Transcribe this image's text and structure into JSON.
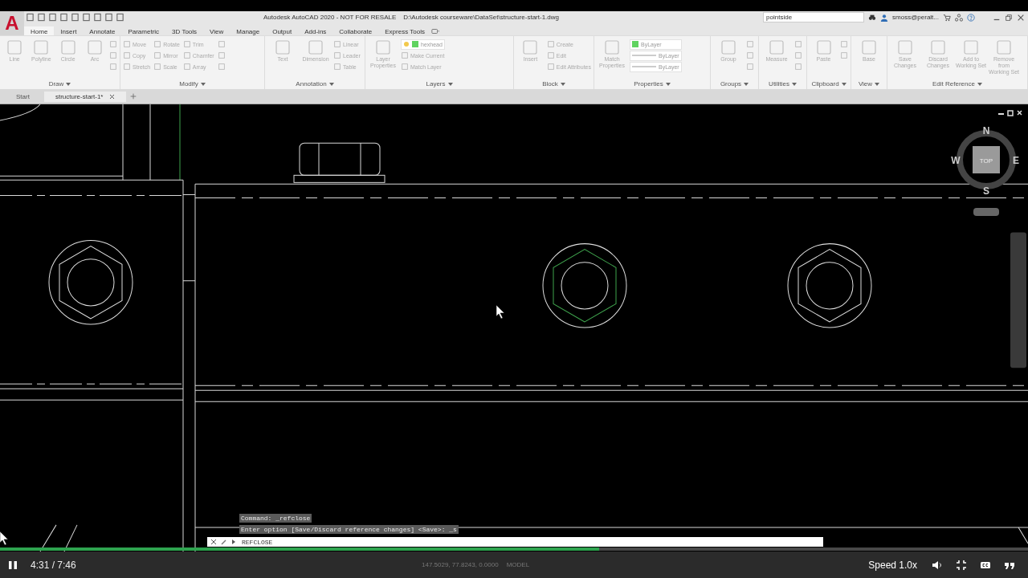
{
  "app_logo": "A",
  "title": "Autodesk AutoCAD 2020 - NOT FOR RESALE    D:\\Autodesk courseware\\DataSet\\structure-start-1.dwg",
  "search": {
    "value": "pointside"
  },
  "user": "smoss@peralt...",
  "ribbon_tabs": [
    {
      "label": "Home",
      "selected": true
    },
    {
      "label": "Insert",
      "selected": false
    },
    {
      "label": "Annotate",
      "selected": false
    },
    {
      "label": "Parametric",
      "selected": false
    },
    {
      "label": "3D Tools",
      "selected": false
    },
    {
      "label": "View",
      "selected": false
    },
    {
      "label": "Manage",
      "selected": false
    },
    {
      "label": "Output",
      "selected": false
    },
    {
      "label": "Add-ins",
      "selected": false
    },
    {
      "label": "Collaborate",
      "selected": false
    },
    {
      "label": "Express Tools",
      "selected": false
    }
  ],
  "panels": [
    {
      "title": "Draw",
      "tools": [
        {
          "kind": "large",
          "label": "Line"
        },
        {
          "kind": "large",
          "label": "Polyline"
        },
        {
          "kind": "large",
          "label": "Circle"
        },
        {
          "kind": "large",
          "label": "Arc"
        },
        {
          "kind": "icon"
        },
        {
          "kind": "icon"
        },
        {
          "kind": "icon"
        }
      ]
    },
    {
      "title": "Modify",
      "tools": [
        {
          "kind": "small",
          "label": "Move"
        },
        {
          "kind": "small",
          "label": "Rotate"
        },
        {
          "kind": "small",
          "label": "Trim"
        },
        {
          "kind": "icon"
        },
        {
          "kind": "small",
          "label": "Copy"
        },
        {
          "kind": "small",
          "label": "Mirror"
        },
        {
          "kind": "small",
          "label": "Chamfer"
        },
        {
          "kind": "icon"
        },
        {
          "kind": "small",
          "label": "Stretch"
        },
        {
          "kind": "small",
          "label": "Scale"
        },
        {
          "kind": "small",
          "label": "Array"
        },
        {
          "kind": "icon"
        }
      ]
    },
    {
      "title": "Annotation",
      "tools": [
        {
          "kind": "large",
          "label": "Text"
        },
        {
          "kind": "large",
          "label": "Dimension"
        },
        {
          "kind": "small",
          "label": "Linear"
        },
        {
          "kind": "small",
          "label": "Leader"
        },
        {
          "kind": "small",
          "label": "Table"
        }
      ]
    },
    {
      "title": "Layers",
      "tools": [
        {
          "kind": "large",
          "label": "Layer Properties"
        },
        {
          "kind": "layer-dropdown",
          "label": "hexhead"
        },
        {
          "kind": "small",
          "label": "Make Current"
        },
        {
          "kind": "small",
          "label": "Match Layer"
        }
      ]
    },
    {
      "title": "Block",
      "tools": [
        {
          "kind": "large",
          "label": "Insert"
        },
        {
          "kind": "small",
          "label": "Create"
        },
        {
          "kind": "small",
          "label": "Edit"
        },
        {
          "kind": "small",
          "label": "Edit Attributes"
        }
      ]
    },
    {
      "title": "Properties",
      "tools": [
        {
          "kind": "large",
          "label": "Match Properties"
        },
        {
          "kind": "color-dropdown",
          "label": "ByLayer"
        },
        {
          "kind": "line-dropdown",
          "label": "ByLayer"
        },
        {
          "kind": "line-dropdown",
          "label": "ByLayer"
        }
      ]
    },
    {
      "title": "Groups",
      "tools": [
        {
          "kind": "large",
          "label": "Group"
        },
        {
          "kind": "icon"
        },
        {
          "kind": "icon"
        },
        {
          "kind": "icon"
        }
      ]
    },
    {
      "title": "Utilities",
      "tools": [
        {
          "kind": "large",
          "label": "Measure"
        },
        {
          "kind": "icon"
        },
        {
          "kind": "icon"
        },
        {
          "kind": "icon"
        }
      ]
    },
    {
      "title": "Clipboard",
      "tools": [
        {
          "kind": "large",
          "label": "Paste"
        },
        {
          "kind": "icon"
        },
        {
          "kind": "icon"
        }
      ]
    },
    {
      "title": "View",
      "tools": [
        {
          "kind": "large",
          "label": "Base"
        }
      ]
    },
    {
      "title": "Edit Reference",
      "tools": [
        {
          "kind": "large",
          "label": "Save Changes"
        },
        {
          "kind": "large",
          "label": "Discard Changes"
        },
        {
          "kind": "large",
          "label": "Add to Working Set"
        },
        {
          "kind": "large",
          "label": "Remove from Working Set"
        }
      ]
    }
  ],
  "document_tabs": [
    {
      "label": "Start",
      "selected": false
    },
    {
      "label": "structure-start-1*",
      "selected": true
    }
  ],
  "viewcube": {
    "face": "TOP",
    "north": "N",
    "south": "S",
    "east": "E",
    "west": "W"
  },
  "command_history": [
    "Command: _refclose",
    "Enter option [Save/Discard reference changes] <Save>: _s"
  ],
  "command_line": {
    "value": "REFCLOSE"
  },
  "status_bar": {
    "coordinates": "147.5029, 77.8243, 0.0000",
    "mode": "MODEL"
  },
  "player": {
    "level": 0.583,
    "time": "4:31 / 7:46",
    "speed": "Speed 1.0x"
  }
}
